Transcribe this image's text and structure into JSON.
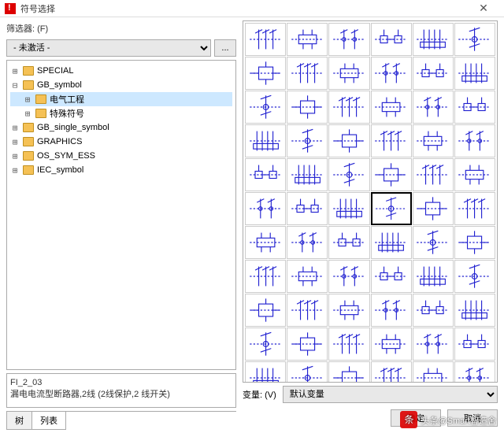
{
  "window": {
    "title": "符号选择",
    "close": "✕"
  },
  "filter": {
    "label": "筛选器: (F)",
    "value": "- 未激活 -",
    "browse": "..."
  },
  "tree": [
    {
      "label": "SPECIAL",
      "expanded": false,
      "level": 0
    },
    {
      "label": "GB_symbol",
      "expanded": true,
      "level": 0
    },
    {
      "label": "电气工程",
      "expanded": false,
      "level": 1,
      "selected": true
    },
    {
      "label": "特殊符号",
      "expanded": false,
      "level": 1
    },
    {
      "label": "GB_single_symbol",
      "expanded": false,
      "level": 0
    },
    {
      "label": "GRAPHICS",
      "expanded": false,
      "level": 0
    },
    {
      "label": "OS_SYM_ESS",
      "expanded": false,
      "level": 0
    },
    {
      "label": "IEC_symbol",
      "expanded": false,
      "level": 0
    }
  ],
  "info": {
    "id": "FI_2_03",
    "desc": "漏电电流型断路器,2线 (2线保护,2 线开关)"
  },
  "tabs": {
    "tree": "树",
    "list": "列表"
  },
  "grid": {
    "rows": 11,
    "cols": 6,
    "selected_index": 33
  },
  "variant": {
    "label": "变量: (V)",
    "value": "默认变量"
  },
  "buttons": {
    "ok": "确定",
    "cancel": "取消"
  },
  "watermark": "头条@Smart智造舍"
}
